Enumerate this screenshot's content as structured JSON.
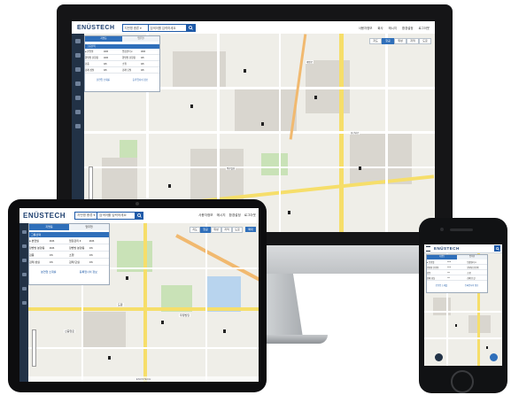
{
  "brand": {
    "logo": "ENÜSTECH",
    "accent": "#2f6fba",
    "header_dark": "#223246"
  },
  "search": {
    "filter_label": "지번명 종류 ▾",
    "placeholder": "검색어를 입력하세요",
    "button_icon": "search-icon"
  },
  "header_links": [
    {
      "icon": "user-icon",
      "label": "사용자정보"
    },
    {
      "icon": "home-icon",
      "label": "회사"
    },
    {
      "icon": "mail-icon",
      "label": "메시지"
    },
    {
      "icon": "gear-icon",
      "label": "환경설정"
    },
    {
      "icon": "logout-icon",
      "label": "로그아웃"
    }
  ],
  "panel": {
    "tabs": [
      "지명등",
      "업무현"
    ],
    "subheader": "그룹선택",
    "rows": [
      {
        "a": "● 본연필",
        "b": "46/6",
        "c": "업장관리 ▾",
        "d": "36/6"
      },
      {
        "a": "양방방 분양용",
        "b": "46/6",
        "c": "양방방 분양용",
        "d": "0/6"
      },
      {
        "a": "검풍",
        "b": "0/6",
        "c": "소행",
        "d": "0/6"
      },
      {
        "a": "검례 성실",
        "b": "0/6",
        "c": "검례 단실",
        "d": "0/6"
      }
    ],
    "buttons": [
      "분연업 소재를",
      "등록업사이 정보"
    ]
  },
  "map_tabs": [
    "지도",
    "항공",
    "위성",
    "지적",
    "도로"
  ],
  "map_labels": [
    "한신당로",
    "평촌빌딩",
    "계명로",
    "Google",
    "도원",
    "우정빌딩",
    "신중앙로"
  ],
  "footer": {
    "copyright": "ENUSTECH",
    "zoom_label": "확대"
  },
  "devices": {
    "monitor": "desktop",
    "tablet": "tablet",
    "phone": "phone"
  }
}
